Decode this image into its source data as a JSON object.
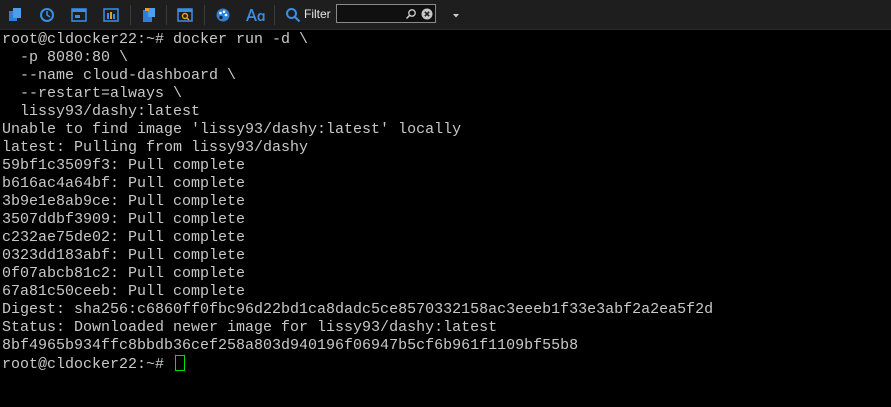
{
  "toolbar": {
    "icons": [
      "copy-icon",
      "history-icon",
      "window-layout-icon",
      "grid-icon",
      "paste-icon",
      "find-window-icon",
      "palette-icon",
      "font-icon",
      "search-icon",
      "clear-icon",
      "dropdown-arrow-icon"
    ],
    "filter_label": "Filter",
    "filter_value": "",
    "accent_color": "#3a8ee6"
  },
  "terminal": {
    "lines": [
      "root@cldocker22:~# docker run -d \\",
      "  -p 8080:80 \\",
      "  --name cloud-dashboard \\",
      "  --restart=always \\",
      "  lissy93/dashy:latest",
      "Unable to find image 'lissy93/dashy:latest' locally",
      "latest: Pulling from lissy93/dashy",
      "59bf1c3509f3: Pull complete",
      "b616ac4a64bf: Pull complete",
      "3b9e1e8ab9ce: Pull complete",
      "3507ddbf3909: Pull complete",
      "c232ae75de02: Pull complete",
      "0323dd183abf: Pull complete",
      "0f07abcb81c2: Pull complete",
      "67a81c50ceeb: Pull complete",
      "Digest: sha256:c6860ff0fbc96d22bd1ca8dadc5ce8570332158ac3eeeb1f33e3abf2a2ea5f2d",
      "Status: Downloaded newer image for lissy93/dashy:latest",
      "8bf4965b934ffc8bbdb36cef258a803d940196f06947b5cf6b961f1109bf55b8"
    ],
    "prompt": "root@cldocker22:~#",
    "text_color": "#c8c8c8",
    "cursor_color": "#00e000"
  }
}
